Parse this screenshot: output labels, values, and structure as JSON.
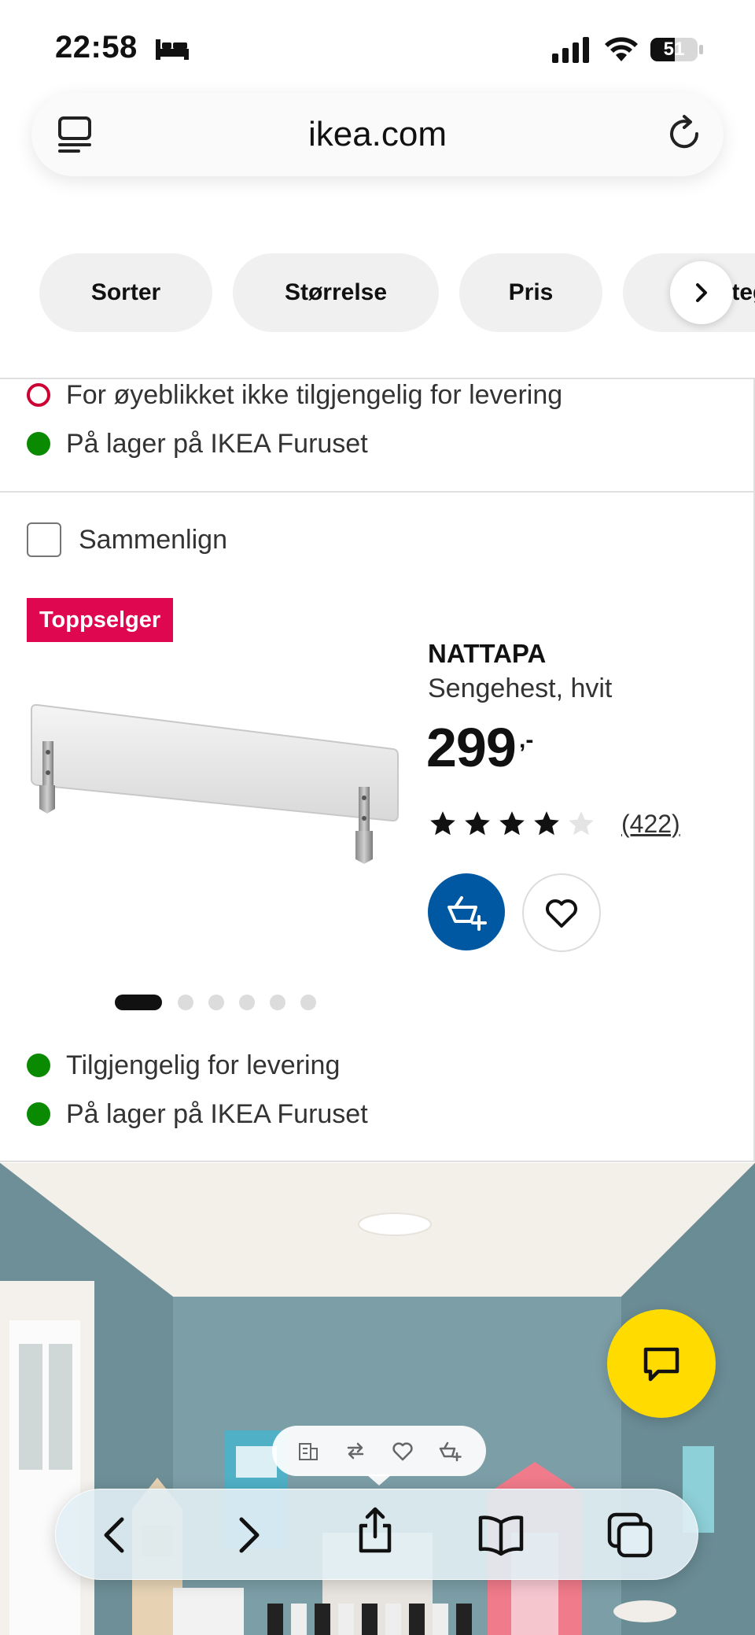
{
  "status_bar": {
    "time": "22:58",
    "battery_level": "51"
  },
  "browser": {
    "url": "ikea.com"
  },
  "filters": {
    "chips": [
      "Sorter",
      "Størrelse",
      "Pris",
      "Kategori"
    ]
  },
  "previous_product": {
    "availability": [
      {
        "text": "For øyeblikket ikke tilgjengelig for levering",
        "status": "unavailable"
      },
      {
        "text": "På lager på IKEA Furuset",
        "status": "in-stock"
      }
    ]
  },
  "product": {
    "compare_label": "Sammenlign",
    "badge": "Toppselger",
    "name": "NATTAPA",
    "description": "Sengehest, hvit",
    "price": "299",
    "price_suffix": ",-",
    "rating_stars": 4,
    "rating_max": 5,
    "rating_count": "(422)",
    "image_count": 6,
    "active_image": 1,
    "availability": [
      {
        "text": "Tilgjengelig for levering",
        "status": "in-stock"
      },
      {
        "text": "På lager på IKEA Furuset",
        "status": "in-stock"
      }
    ]
  },
  "colors": {
    "ikea_blue": "#0058a3",
    "badge_red": "#e00751",
    "chat_yellow": "#ffdb00",
    "stock_green": "#0a8a00"
  },
  "icons": {
    "status": [
      "bed-icon",
      "signal-icon",
      "wifi-icon",
      "battery-icon"
    ],
    "address_bar": [
      "tabs-icon",
      "reload-icon"
    ],
    "mini_toolbar": [
      "store-icon",
      "swap-icon",
      "heart-icon",
      "cart-icon"
    ],
    "safari_toolbar": [
      "back-icon",
      "forward-icon",
      "share-icon",
      "bookmarks-icon",
      "tabs-overview-icon"
    ]
  }
}
